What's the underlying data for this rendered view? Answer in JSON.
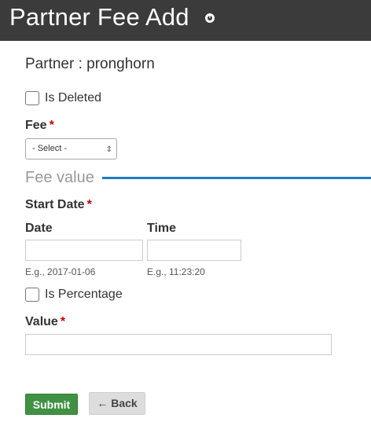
{
  "header": {
    "title": "Partner Fee Add",
    "icon": "plus-circle-icon"
  },
  "subtitle": "Partner : pronghorn",
  "is_deleted": {
    "label": "Is Deleted",
    "checked": false
  },
  "fee": {
    "label": "Fee",
    "required_mark": "*",
    "selected": "- Select -"
  },
  "fee_value_section": {
    "title": "Fee value"
  },
  "start_date": {
    "label": "Start Date",
    "required_mark": "*",
    "date_label": "Date",
    "time_label": "Time",
    "date_hint": "E.g., 2017-01-06",
    "time_hint": "E.g., 11:23:20",
    "date_value": "",
    "time_value": ""
  },
  "is_percentage": {
    "label": "Is Percentage",
    "checked": false
  },
  "value": {
    "label": "Value",
    "required_mark": "*",
    "value": ""
  },
  "buttons": {
    "submit_label": "Submit",
    "back_label": "← Back"
  },
  "colors": {
    "header_bg": "#3b3b3b",
    "accent_line": "#1f7bbf",
    "submit_bg": "#3f9143",
    "required": "#cc0000"
  }
}
